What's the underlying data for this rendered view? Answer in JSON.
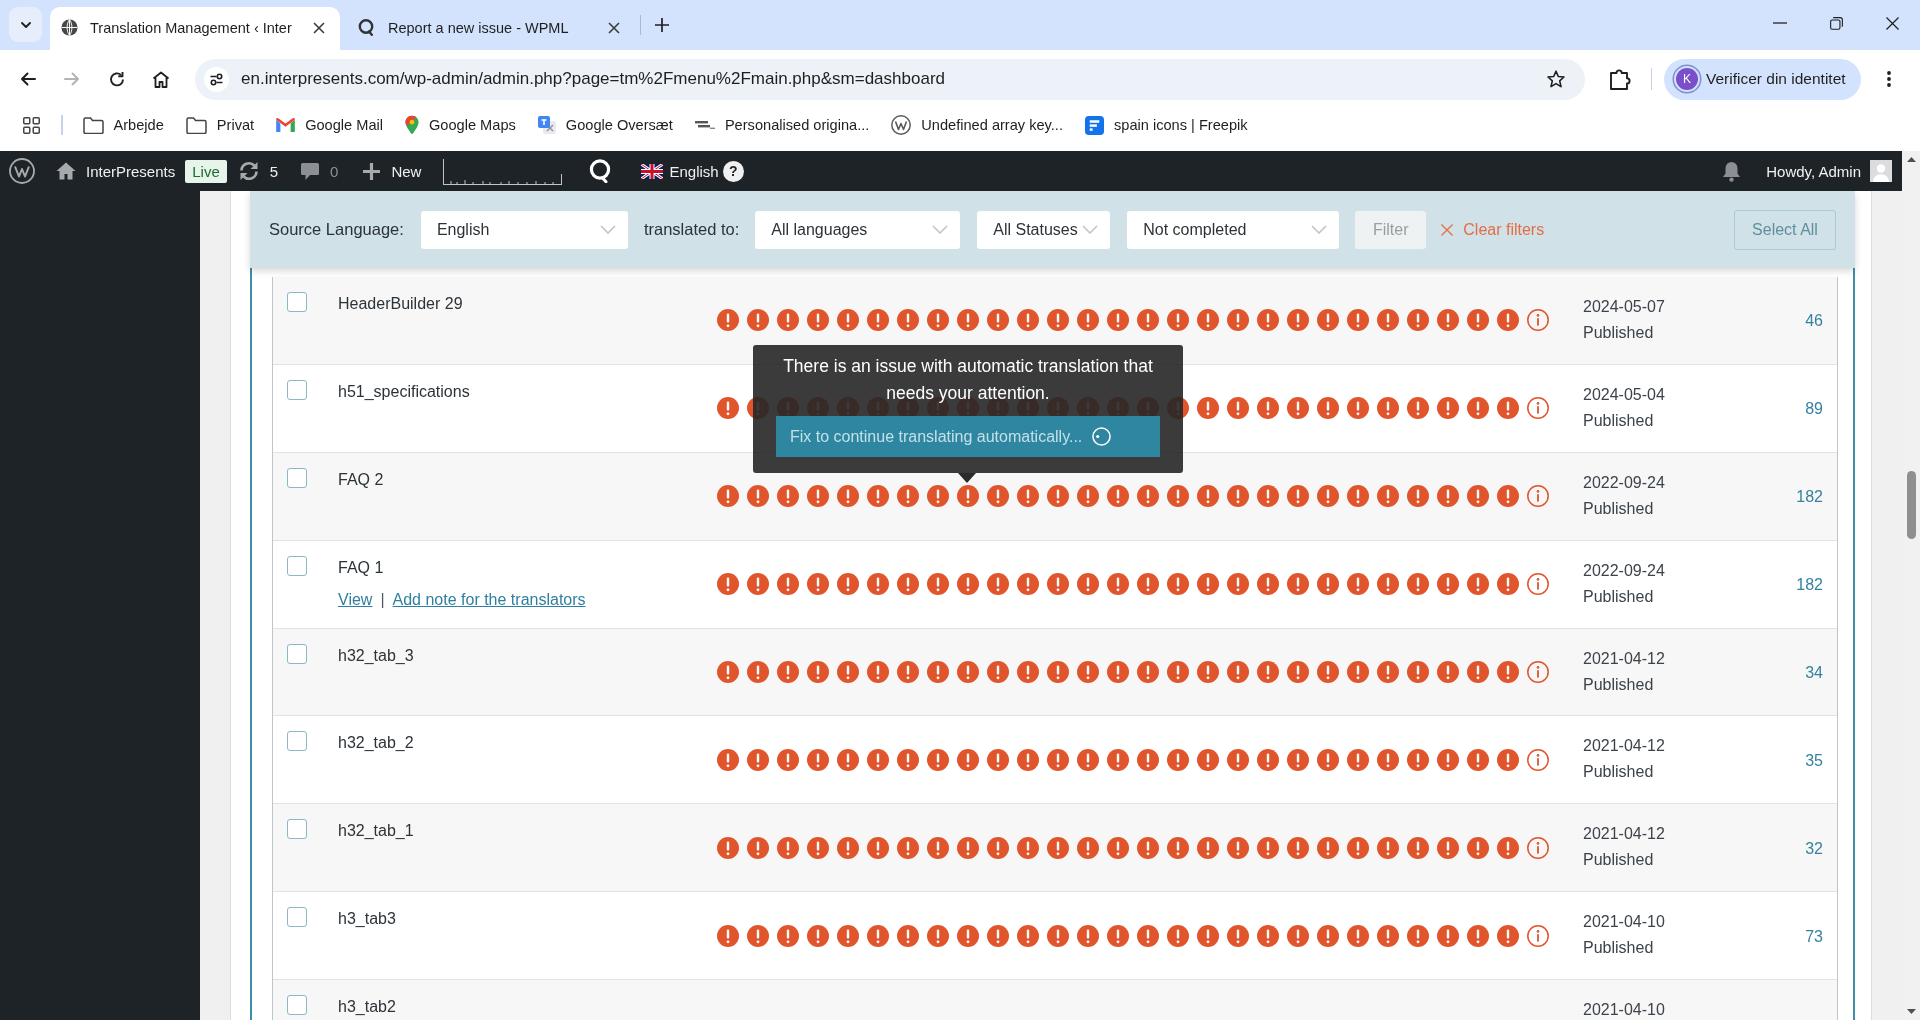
{
  "browser": {
    "tabs": [
      {
        "kind": "globe",
        "title": "Translation Management ‹ Inter",
        "selected": true
      },
      {
        "kind": "wpml",
        "title": "Report a new issue - WPML",
        "selected": false
      }
    ],
    "address": "en.interpresents.com/wp-admin/admin.php?page=tm%2Fmenu%2Fmain.php&sm=dashboard",
    "profile": {
      "initial": "K",
      "label": "Verificer din identitet"
    },
    "bookmarks": [
      {
        "kind": "folder",
        "label": "Arbejde"
      },
      {
        "kind": "folder",
        "label": "Privat"
      },
      {
        "kind": "gmail",
        "label": "Google Mail"
      },
      {
        "kind": "maps",
        "label": "Google Maps"
      },
      {
        "kind": "translate",
        "label": "Google Oversæt"
      },
      {
        "kind": "makeyour",
        "label": "Personalised origina..."
      },
      {
        "kind": "wordpress",
        "label": "Undefined array key..."
      },
      {
        "kind": "freepik",
        "label": "spain icons | Freepik"
      }
    ]
  },
  "admin_bar": {
    "site": "InterPresents",
    "badge": "Live",
    "updates": "5",
    "comments": "0",
    "new": "New",
    "language": "English",
    "help": "?",
    "greeting": "Howdy, Admin"
  },
  "filters": {
    "source_label": "Source Language:",
    "source": "English",
    "target_label": "translated to:",
    "target": "All languages",
    "status": "All Statuses",
    "completion": "Not completed",
    "filter": {
      "label": "Filter",
      "disabled": true
    },
    "clear": "Clear filters",
    "select_all": {
      "label": "Select All",
      "disabled": true
    }
  },
  "rows": [
    {
      "title": "HeaderBuilder 29",
      "checked": false,
      "languages": [
        {
          "attention": true
        },
        {
          "attention": true
        },
        {
          "attention": true
        },
        {
          "attention": true
        },
        {
          "attention": true
        },
        {
          "attention": true
        },
        {
          "attention": true
        },
        {
          "attention": true
        },
        {
          "attention": true
        },
        {
          "attention": true
        },
        {
          "attention": true
        },
        {
          "attention": true
        },
        {
          "attention": true
        },
        {
          "attention": true
        },
        {
          "attention": true
        },
        {
          "attention": true
        },
        {
          "attention": true
        },
        {
          "attention": true
        },
        {
          "attention": true
        },
        {
          "attention": true
        },
        {
          "attention": true
        },
        {
          "attention": true
        },
        {
          "attention": true
        },
        {
          "attention": true
        },
        {
          "attention": true
        },
        {
          "attention": true
        },
        {
          "attention": true
        }
      ],
      "date": "2024-05-07",
      "status": "Published",
      "number": "46"
    },
    {
      "title": "h51_specifications",
      "checked": false,
      "languages": [
        {
          "attention": true
        },
        {
          "attention": true
        },
        {
          "attention": true
        },
        {
          "attention": true
        },
        {
          "attention": true
        },
        {
          "attention": true
        },
        {
          "attention": true
        },
        {
          "attention": true
        },
        {
          "attention": true
        },
        {
          "attention": true
        },
        {
          "attention": true
        },
        {
          "attention": true
        },
        {
          "attention": true
        },
        {
          "attention": true
        },
        {
          "attention": true
        },
        {
          "attention": true
        },
        {
          "attention": true
        },
        {
          "attention": true
        },
        {
          "attention": true
        },
        {
          "attention": true
        },
        {
          "attention": true
        },
        {
          "attention": true
        },
        {
          "attention": true
        },
        {
          "attention": true
        },
        {
          "attention": true
        },
        {
          "attention": true
        },
        {
          "attention": true
        }
      ],
      "date": "2024-05-04",
      "status": "Published",
      "number": "89"
    },
    {
      "title": "FAQ 2",
      "checked": false,
      "languages": [
        {
          "attention": true
        },
        {
          "attention": true
        },
        {
          "attention": true
        },
        {
          "attention": true
        },
        {
          "attention": true
        },
        {
          "attention": true
        },
        {
          "attention": true
        },
        {
          "attention": true
        },
        {
          "attention": true
        },
        {
          "attention": true
        },
        {
          "attention": true
        },
        {
          "attention": true
        },
        {
          "attention": true
        },
        {
          "attention": true
        },
        {
          "attention": true
        },
        {
          "attention": true
        },
        {
          "attention": true
        },
        {
          "attention": true
        },
        {
          "attention": true
        },
        {
          "attention": true
        },
        {
          "attention": true
        },
        {
          "attention": true
        },
        {
          "attention": true
        },
        {
          "attention": true
        },
        {
          "attention": true
        },
        {
          "attention": true
        },
        {
          "attention": true
        }
      ],
      "date": "2022-09-24",
      "status": "Published",
      "number": "182"
    },
    {
      "title": "FAQ 1",
      "checked": false,
      "actions": [
        "View",
        "Add note for the translators"
      ],
      "separator": "|",
      "languages": [
        {
          "attention": true
        },
        {
          "attention": true
        },
        {
          "attention": true
        },
        {
          "attention": true
        },
        {
          "attention": true
        },
        {
          "attention": true
        },
        {
          "attention": true
        },
        {
          "attention": true
        },
        {
          "attention": true
        },
        {
          "attention": true
        },
        {
          "attention": true
        },
        {
          "attention": true
        },
        {
          "attention": true
        },
        {
          "attention": true
        },
        {
          "attention": true
        },
        {
          "attention": true
        },
        {
          "attention": true
        },
        {
          "attention": true
        },
        {
          "attention": true
        },
        {
          "attention": true
        },
        {
          "attention": true
        },
        {
          "attention": true
        },
        {
          "attention": true
        },
        {
          "attention": true
        },
        {
          "attention": true
        },
        {
          "attention": true
        },
        {
          "attention": true
        }
      ],
      "date": "2022-09-24",
      "status": "Published",
      "number": "182"
    },
    {
      "title": "h32_tab_3",
      "checked": false,
      "languages": [
        {
          "attention": true
        },
        {
          "attention": true
        },
        {
          "attention": true
        },
        {
          "attention": true
        },
        {
          "attention": true
        },
        {
          "attention": true
        },
        {
          "attention": true
        },
        {
          "attention": true
        },
        {
          "attention": true
        },
        {
          "attention": true
        },
        {
          "attention": true
        },
        {
          "attention": true
        },
        {
          "attention": true
        },
        {
          "attention": true
        },
        {
          "attention": true
        },
        {
          "attention": true
        },
        {
          "attention": true
        },
        {
          "attention": true
        },
        {
          "attention": true
        },
        {
          "attention": true
        },
        {
          "attention": true
        },
        {
          "attention": true
        },
        {
          "attention": true
        },
        {
          "attention": true
        },
        {
          "attention": true
        },
        {
          "attention": true
        },
        {
          "attention": true
        }
      ],
      "date": "2021-04-12",
      "status": "Published",
      "number": "34"
    },
    {
      "title": "h32_tab_2",
      "checked": false,
      "languages": [
        {
          "attention": true
        },
        {
          "attention": true
        },
        {
          "attention": true
        },
        {
          "attention": true
        },
        {
          "attention": true
        },
        {
          "attention": true
        },
        {
          "attention": true
        },
        {
          "attention": true
        },
        {
          "attention": true
        },
        {
          "attention": true
        },
        {
          "attention": true
        },
        {
          "attention": true
        },
        {
          "attention": true
        },
        {
          "attention": true
        },
        {
          "attention": true
        },
        {
          "attention": true
        },
        {
          "attention": true
        },
        {
          "attention": true
        },
        {
          "attention": true
        },
        {
          "attention": true
        },
        {
          "attention": true
        },
        {
          "attention": true
        },
        {
          "attention": true
        },
        {
          "attention": true
        },
        {
          "attention": true
        },
        {
          "attention": true
        },
        {
          "attention": true
        }
      ],
      "date": "2021-04-12",
      "status": "Published",
      "number": "35"
    },
    {
      "title": "h32_tab_1",
      "checked": false,
      "languages": [
        {
          "attention": true
        },
        {
          "attention": true
        },
        {
          "attention": true
        },
        {
          "attention": true
        },
        {
          "attention": true
        },
        {
          "attention": true
        },
        {
          "attention": true
        },
        {
          "attention": true
        },
        {
          "attention": true
        },
        {
          "attention": true
        },
        {
          "attention": true
        },
        {
          "attention": true
        },
        {
          "attention": true
        },
        {
          "attention": true
        },
        {
          "attention": true
        },
        {
          "attention": true
        },
        {
          "attention": true
        },
        {
          "attention": true
        },
        {
          "attention": true
        },
        {
          "attention": true
        },
        {
          "attention": true
        },
        {
          "attention": true
        },
        {
          "attention": true
        },
        {
          "attention": true
        },
        {
          "attention": true
        },
        {
          "attention": true
        },
        {
          "attention": true
        }
      ],
      "date": "2021-04-12",
      "status": "Published",
      "number": "32"
    },
    {
      "title": "h3_tab3",
      "checked": false,
      "languages": [
        {
          "attention": true
        },
        {
          "attention": true
        },
        {
          "attention": true
        },
        {
          "attention": true
        },
        {
          "attention": true
        },
        {
          "attention": true
        },
        {
          "attention": true
        },
        {
          "attention": true
        },
        {
          "attention": true
        },
        {
          "attention": true
        },
        {
          "attention": true
        },
        {
          "attention": true
        },
        {
          "attention": true
        },
        {
          "attention": true
        },
        {
          "attention": true
        },
        {
          "attention": true
        },
        {
          "attention": true
        },
        {
          "attention": true
        },
        {
          "attention": true
        },
        {
          "attention": true
        },
        {
          "attention": true
        },
        {
          "attention": true
        },
        {
          "attention": true
        },
        {
          "attention": true
        },
        {
          "attention": true
        },
        {
          "attention": true
        },
        {
          "attention": true
        }
      ],
      "date": "2021-04-10",
      "status": "Published",
      "number": "73"
    },
    {
      "title": "h3_tab2",
      "checked": false,
      "date": "2021-04-10"
    }
  ],
  "tooltip": {
    "message": "There is an issue with automatic translation that needs your attention.",
    "button": "Fix to continue translating automatically..."
  }
}
